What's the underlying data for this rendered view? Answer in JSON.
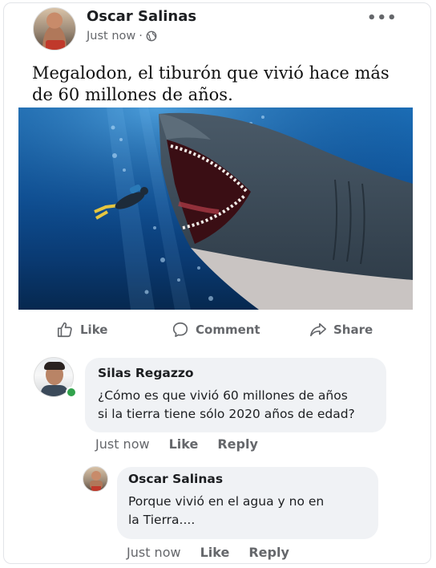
{
  "post": {
    "author": "Oscar Salinas",
    "timestamp": "Just now",
    "separator": "·",
    "privacy_icon": "globe-icon",
    "more_icon": "more-options-icon",
    "more_label": "•••",
    "text": "Megalodon, el tiburón que vivió hace más de 60 millones de años."
  },
  "actions": {
    "like": "Like",
    "comment": "Comment",
    "share": "Share"
  },
  "comments": [
    {
      "author": "Silas Regazzo",
      "text_line1": "¿Cómo es que vivió 60 millones de años",
      "text_line2": "si la tierra tiene sólo 2020 años de edad?",
      "time": "Just now",
      "like": "Like",
      "reply": "Reply"
    },
    {
      "author": "Oscar Salinas",
      "text_line1": "Porque vivió en el agua y no en",
      "text_line2": "la Tierra....",
      "time": "Just now",
      "like": "Like",
      "reply": "Reply"
    }
  ],
  "colors": {
    "secondary_text": "#65676b",
    "bubble": "#f0f2f5",
    "online": "#31a24c"
  }
}
